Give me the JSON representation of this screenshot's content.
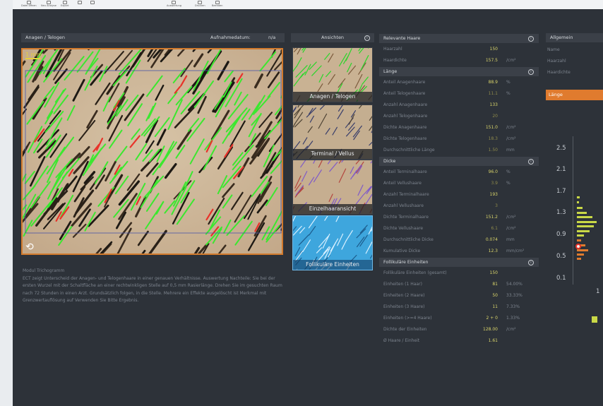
{
  "toolbar": {
    "items": [
      "Datei öffnen",
      "Neu Analyse",
      "Export",
      "",
      "",
      "Auswertung",
      "Drucken",
      "Beenden"
    ]
  },
  "left_panel": {
    "title": "Anagen / Telogen",
    "date_label": "Aufnahmedatum:",
    "date_value": "n/a",
    "scale_label": "1 mm"
  },
  "views": {
    "title": "Ansichten",
    "items": [
      "Anagen / Telogen",
      "Terminal / Vellus",
      "Einzelhaaransicht",
      "Follikuläre Einheiten"
    ],
    "selected": "Follikuläre Einheiten"
  },
  "description": {
    "title": "Modul Trichogramm",
    "text": "ECT zeigt Unterscheid der Anagen- und Telogenhaare in einer genauen Verhältnisse. Auswertung Nachteile: Sie bei der ersten Wurzel mit der Schaltfläche an einer rechtwinkligen Stelle auf 0,5 mm Rasierlänge. Drehen Sie im gesuchten Raum nach 72 Stunden in einen Arzt. Grundsätzlich folgen, in die Stelle. Mehrere ein Effekte ausgelöscht ist Merkmal mit Grenzwertauflösung auf Verwenden Sie Bitte Ergebnis."
  },
  "table": {
    "sections": [
      {
        "title": "Relevante Haare",
        "rows": [
          {
            "label": "Haarzahl",
            "value": "150",
            "unit": ""
          },
          {
            "label": "Haardichte",
            "value": "157.5",
            "unit": "/cm²"
          }
        ]
      },
      {
        "title": "Länge",
        "rows": [
          {
            "label": "Anteil Anagenhaare",
            "value": "88.9",
            "unit": "%"
          },
          {
            "label": "Anteil Telogenhaare",
            "value": "11.1",
            "unit": "%",
            "dim": true
          },
          {
            "label": "Anzahl Anagenhaare",
            "value": "133",
            "unit": ""
          },
          {
            "label": "Anzahl Telogenhaare",
            "value": "20",
            "unit": "",
            "dim": true
          },
          {
            "label": "Dichte Anagenhaare",
            "value": "151.0",
            "unit": "/cm²"
          },
          {
            "label": "Dichte Telogenhaare",
            "value": "18.3",
            "unit": "/cm²",
            "dim": true
          },
          {
            "label": "Durchschnittliche Länge",
            "value": "1.50",
            "unit": "mm",
            "dim": true
          }
        ]
      },
      {
        "title": "Dicke",
        "rows": [
          {
            "label": "Anteil Terminalhaare",
            "value": "96.0",
            "unit": "%"
          },
          {
            "label": "Anteil Vellushaare",
            "value": "3.9",
            "unit": "%",
            "dim": true
          },
          {
            "label": "Anzahl Terminalhaare",
            "value": "193",
            "unit": ""
          },
          {
            "label": "Anzahl Vellushaare",
            "value": "3",
            "unit": "",
            "dim": true
          },
          {
            "label": "Dichte Terminalhaare",
            "value": "151.2",
            "unit": "/cm²"
          },
          {
            "label": "Dichte Vellushaare",
            "value": "6.1",
            "unit": "/cm²",
            "dim": true
          },
          {
            "label": "Durchschnittliche Dicke",
            "value": "0.074",
            "unit": "mm"
          },
          {
            "label": "Kumulative Dicke",
            "value": "12.3",
            "unit": "mm/cm²"
          }
        ]
      },
      {
        "title": "Follikuläre Einheiten",
        "rows": [
          {
            "label": "Follikuläre Einheiten (gesamt)",
            "value": "150",
            "unit": ""
          },
          {
            "label": "Einheiten (1 Haar)",
            "value": "81",
            "unit": "54.00%"
          },
          {
            "label": "Einheiten (2 Haare)",
            "value": "50",
            "unit": "33.33%"
          },
          {
            "label": "Einheiten (3 Haare)",
            "value": "11",
            "unit": "7.33%"
          },
          {
            "label": "Einheiten (>=4 Haare)",
            "value": "2 + 0",
            "unit": "1.33%"
          },
          {
            "label": "Dichte der Einheiten",
            "value": "128.00",
            "unit": "/cm²"
          },
          {
            "label": "Ø Haare / Einheit",
            "value": "1.61",
            "unit": ""
          }
        ]
      }
    ]
  },
  "general": {
    "title": "Allgemein",
    "rows": [
      "Name",
      "Haarzahl",
      "Haardichte"
    ],
    "tab_label": "Länge"
  },
  "axis": {
    "ticks": [
      "2.5",
      "2.1",
      "1.7",
      "1.3",
      "0.9",
      "0.5",
      "0.1"
    ],
    "next_tick": "1"
  },
  "colors": {
    "accent": "#e07b2e",
    "anagen": "#3be82f",
    "telogen": "#e8332a",
    "value": "#d9d46a"
  }
}
